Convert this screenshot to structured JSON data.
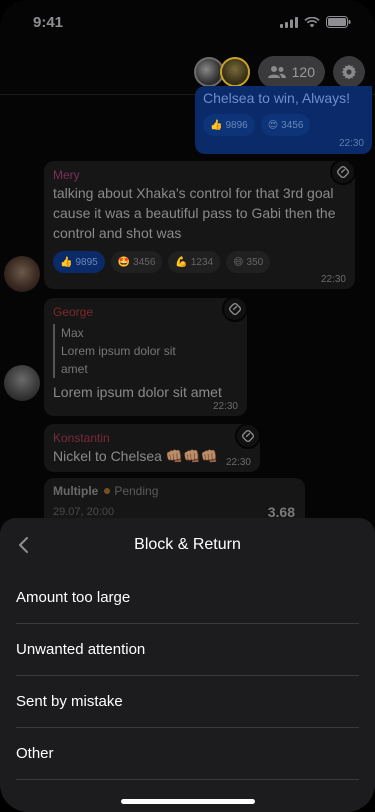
{
  "status_bar": {
    "time": "9:41"
  },
  "header": {
    "member_count": "120"
  },
  "own_message": {
    "text": "Chelsea to win, Always!",
    "reactions": [
      {
        "emoji": "👍",
        "count": "9896"
      },
      {
        "emoji": "😍",
        "count": "3456"
      }
    ],
    "time": "22:30"
  },
  "messages": {
    "mery": {
      "sender": "Mery",
      "text": "talking about Xhaka's control for that 3rd goal cause it was a beautiful pass to Gabi then the control and shot was",
      "reactions": [
        {
          "emoji": "👍",
          "count": "9895"
        },
        {
          "emoji": "🤩",
          "count": "3456"
        },
        {
          "emoji": "💪",
          "count": "1234"
        },
        {
          "emoji": "😄",
          "count": "350"
        }
      ],
      "time": "22:30"
    },
    "george": {
      "sender": "George",
      "quote_author": "Max",
      "quote_line1": "Lorem ipsum dolor sit",
      "quote_line2": "amet",
      "text": "Lorem ipsum dolor sit amet",
      "time": "22:30"
    },
    "konstantin": {
      "sender": "Konstantin",
      "text": "Nickel to Chelsea 👊🏽👊🏽👊🏽",
      "time": "22:30"
    },
    "bet": {
      "type": "Multiple",
      "status": "Pending",
      "date": "29.07, 20:00",
      "odds": "3.68"
    }
  },
  "sheet": {
    "title": "Block & Return",
    "options": [
      "Amount too large",
      "Unwanted attention",
      "Sent by mistake",
      "Other"
    ]
  },
  "colors": {
    "sheet_bg": "#1c1c1e",
    "own_bubble": "#0a2a6a",
    "pending": "#e08a2c"
  }
}
